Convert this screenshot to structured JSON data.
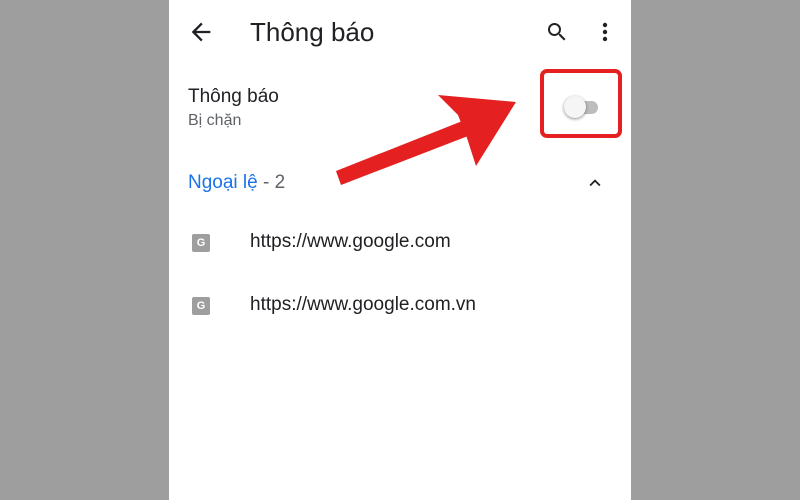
{
  "toolbar": {
    "title": "Thông báo",
    "back_icon": "arrow-back-icon",
    "search_icon": "search-icon",
    "more_icon": "more-vert-icon"
  },
  "setting": {
    "title": "Thông báo",
    "status": "Bị chặn",
    "toggle_on": false
  },
  "exceptions": {
    "label": "Ngoại lệ",
    "count_text": " - 2",
    "expanded": true,
    "sites": [
      {
        "favicon": "G",
        "url": "https://www.google.com"
      },
      {
        "favicon": "G",
        "url": "https://www.google.com.vn"
      }
    ]
  },
  "annotation": {
    "color": "#e52020"
  },
  "colors": {
    "accent": "#1a73e8",
    "background": "#9e9e9e"
  }
}
